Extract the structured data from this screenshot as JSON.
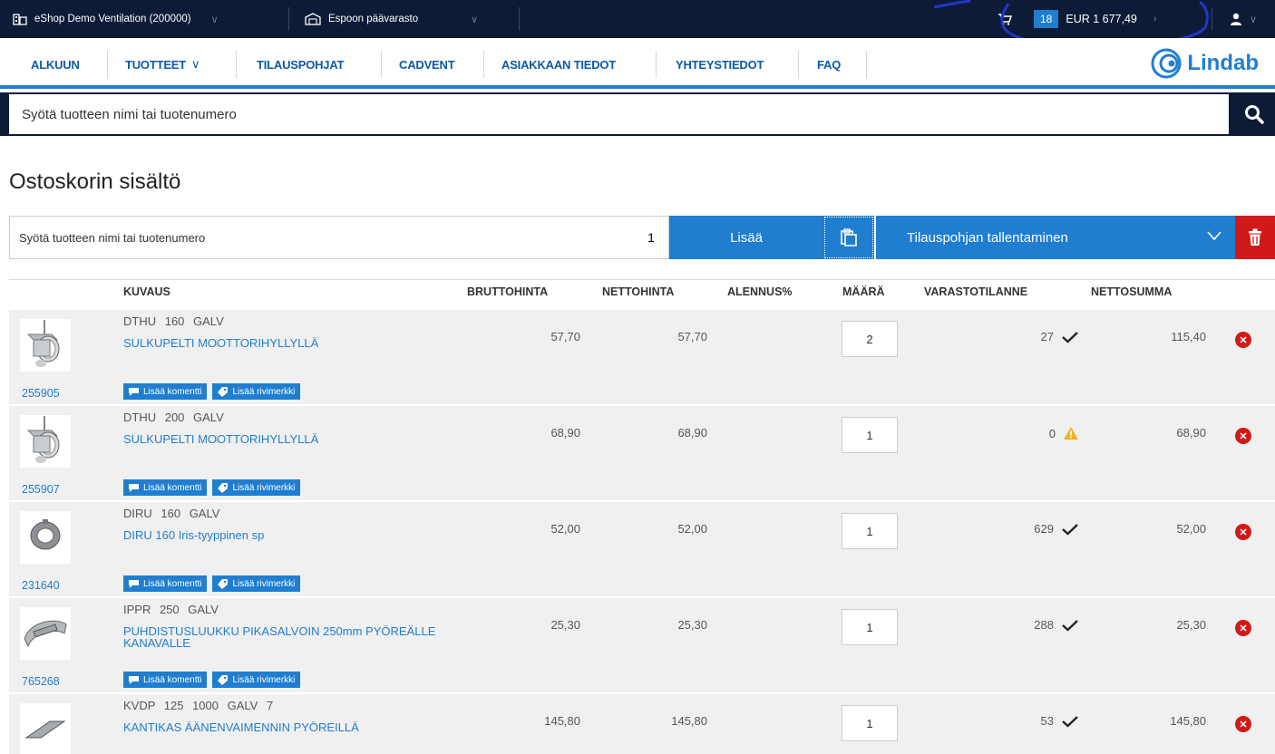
{
  "topbar": {
    "company": "eShop Demo Ventilation (200000)",
    "warehouse": "Espoon päävarasto",
    "cart_count": "18",
    "cart_total": "EUR 1 677,49"
  },
  "nav": {
    "items": [
      "ALKUUN",
      "TUOTTEET",
      "TILAUSPOHJAT",
      "CADVENT",
      "ASIAKKAAN TIEDOT",
      "YHTEYSTIEDOT",
      "FAQ"
    ],
    "logo": "Lindab"
  },
  "search": {
    "placeholder": "Syötä tuotteen nimi tai tuotenumero"
  },
  "page_title": "Ostoskorin sisältö",
  "add_row": {
    "placeholder": "Syötä tuotteen nimi tai tuotenumero",
    "quantity": "1",
    "add_label": "Lisää",
    "save_template_label": "Tilauspohjan tallentaminen"
  },
  "table": {
    "headers": {
      "description": "KUVAUS",
      "gross": "BRUTTOHINTA",
      "net": "NETTOHINTA",
      "discount": "ALENNUS%",
      "quantity": "MÄÄRÄ",
      "stock": "VARASTOTILANNE",
      "net_sum": "NETTOSUMMA"
    },
    "comment_label": "Lisää komentti",
    "row_mark_label": "Lisää rivimerkki",
    "rows": [
      {
        "product_no": "255905",
        "code": "DTHU 160 GALV",
        "description": "SULKUPELTI MOOTTORIHYLLYLLÄ",
        "gross": "57,70",
        "net": "57,70",
        "quantity": "2",
        "stock": "27",
        "stock_status": "ok",
        "net_sum": "115,40",
        "icon": "damper-motor-image"
      },
      {
        "product_no": "255907",
        "code": "DTHU 200 GALV",
        "description": "SULKUPELTI MOOTTORIHYLLYLLÄ",
        "gross": "68,90",
        "net": "68,90",
        "quantity": "1",
        "stock": "0",
        "stock_status": "warning",
        "net_sum": "68,90",
        "icon": "damper-motor-image"
      },
      {
        "product_no": "231640",
        "code": "DIRU 160 GALV",
        "description": "DIRU 160 Iris-tyyppinen sp",
        "gross": "52,00",
        "net": "52,00",
        "quantity": "1",
        "stock": "629",
        "stock_status": "ok",
        "net_sum": "52,00",
        "icon": "iris-damper-image"
      },
      {
        "product_no": "765268",
        "code": "IPPR 250 GALV",
        "description": "PUHDISTUSLUUKKU PIKASALVOIN 250mm PYÖREÄLLE KANAVALLE",
        "gross": "25,30",
        "net": "25,30",
        "quantity": "1",
        "stock": "288",
        "stock_status": "ok",
        "net_sum": "25,30",
        "icon": "inspection-hatch-image"
      },
      {
        "product_no": "",
        "code": "KVDP 125 1000 GALV 7",
        "description": "KANTIKAS ÄÄNENVAIMENNIN PYÖREILLÄ",
        "gross": "145,80",
        "net": "145,80",
        "quantity": "1",
        "stock": "53",
        "stock_status": "ok",
        "net_sum": "145,80",
        "icon": "silencer-image"
      }
    ]
  },
  "colors": {
    "brand_blue": "#1f7ed0",
    "dark": "#0d1b36",
    "danger": "#d01a1a",
    "warning": "#f5b324"
  }
}
